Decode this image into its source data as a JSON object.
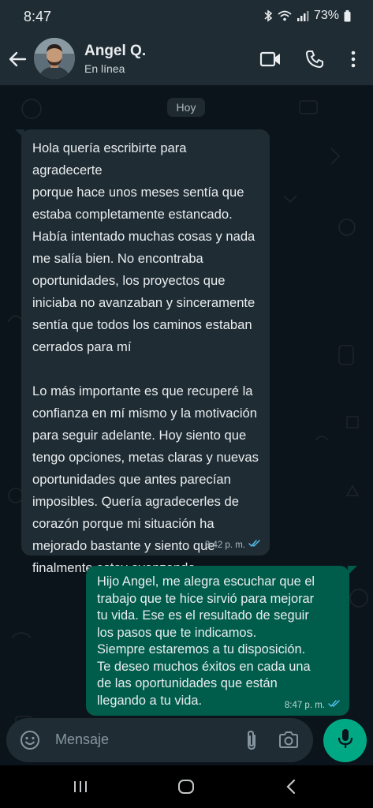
{
  "status_bar": {
    "time": "8:47",
    "battery": "73%",
    "icons": [
      "bluetooth-icon",
      "wifi-icon",
      "signal-icon",
      "battery-icon"
    ]
  },
  "header": {
    "contact_name": "Angel Q.",
    "contact_status": "En línea",
    "icons": [
      "back-arrow-icon",
      "video-call-icon",
      "phone-icon",
      "more-vert-icon"
    ]
  },
  "chat": {
    "day_label": "Hoy",
    "messages": [
      {
        "direction": "incoming",
        "paragraphs": [
          "Hola quería escribirte para agradecerte\nporque hace unos meses sentía que\nestaba completamente estancado.\nHabía intentado muchas cosas y nada\nme salía bien. No encontraba\noportunidades, los proyectos que\niniciaba no avanzaban y sinceramente\nsentía que todos los caminos estaban\ncerrados para mí",
          "Lo más importante es que recuperé la\nconfianza en mí mismo y la motivación\npara seguir adelante. Hoy siento que\ntengo opciones, metas claras y nuevas\noportunidades que antes parecían\nimposibles. Quería agradecerles de\ncorazón porque mi situación ha\nmejorado bastante y siento que\nfinalmente estoy avanzando."
        ],
        "time": "8:42 p. m."
      },
      {
        "direction": "outgoing",
        "paragraphs": [
          "Hijo Angel, me alegra escuchar que el\ntrabajo que te hice sirvió para mejorar\ntu vida. Ese es el resultado de seguir\nlos pasos que te indicamos.\nSiempre estaremos a tu disposición.\nTe deseo muchos éxitos en cada una\nde las oportunidades que están\nllegando a tu vida."
        ],
        "time": "8:47 p. m."
      }
    ]
  },
  "composer": {
    "placeholder": "Mensaje",
    "icons": [
      "emoji-icon",
      "attach-icon",
      "camera-icon",
      "mic-icon"
    ]
  },
  "colors": {
    "background": "#0b141a",
    "header": "#1f2c34",
    "incoming_bubble": "#1f2c34",
    "outgoing_bubble": "#005c4b",
    "accent": "#00a884",
    "read_ticks": "#53bdeb"
  }
}
